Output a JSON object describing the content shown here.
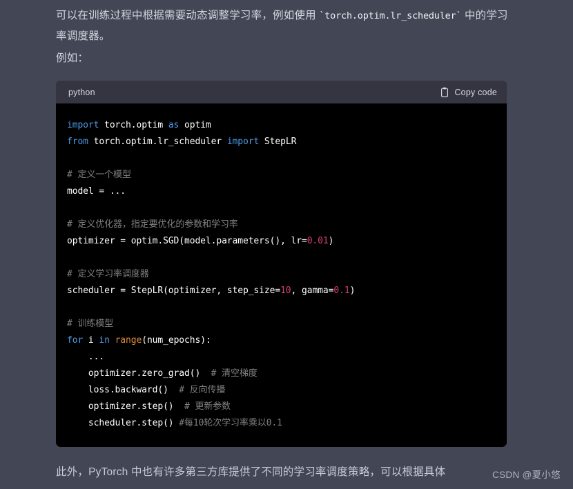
{
  "page": {
    "background_color": "#434654",
    "text_color": "#d2d4de"
  },
  "prose": {
    "intro_before_code": "可以在训练过程中根据需要动态调整学习率，例如使用 ",
    "intro_inline_code": "`torch.optim.lr_scheduler`",
    "intro_after_code": " 中的学习率调度器。",
    "example_label": "例如：",
    "closing": "此外，PyTorch 中也有许多第三方库提供了不同的学习率调度策略，可以根据具体"
  },
  "code_block": {
    "language": "python",
    "copy_label": "Copy code",
    "copy_icon": "clipboard-icon",
    "header_bg": "#343541",
    "body_bg": "#000000",
    "colors": {
      "keyword": "#4e9ae6",
      "builtin": "#e08b3c",
      "number": "#d63f6a",
      "comment": "#808080",
      "plain": "#ffffff"
    },
    "lines": [
      [
        {
          "t": "import",
          "c": "kw"
        },
        {
          "t": " torch.optim ",
          "c": "plain"
        },
        {
          "t": "as",
          "c": "kw"
        },
        {
          "t": " optim",
          "c": "plain"
        }
      ],
      [
        {
          "t": "from",
          "c": "kw"
        },
        {
          "t": " torch.optim.lr_scheduler ",
          "c": "plain"
        },
        {
          "t": "import",
          "c": "kw"
        },
        {
          "t": " StepLR",
          "c": "plain"
        }
      ],
      [],
      [
        {
          "t": "# 定义一个模型",
          "c": "cmt"
        }
      ],
      [
        {
          "t": "model = ...",
          "c": "plain"
        }
      ],
      [],
      [
        {
          "t": "# 定义优化器，指定要优化的参数和学习率",
          "c": "cmt"
        }
      ],
      [
        {
          "t": "optimizer = optim.SGD(model.parameters(), lr=",
          "c": "plain"
        },
        {
          "t": "0.01",
          "c": "num"
        },
        {
          "t": ")",
          "c": "plain"
        }
      ],
      [],
      [
        {
          "t": "# 定义学习率调度器",
          "c": "cmt"
        }
      ],
      [
        {
          "t": "scheduler = StepLR(optimizer, step_size=",
          "c": "plain"
        },
        {
          "t": "10",
          "c": "num"
        },
        {
          "t": ", gamma=",
          "c": "plain"
        },
        {
          "t": "0.1",
          "c": "num"
        },
        {
          "t": ")",
          "c": "plain"
        }
      ],
      [],
      [
        {
          "t": "# 训练模型",
          "c": "cmt"
        }
      ],
      [
        {
          "t": "for",
          "c": "kw"
        },
        {
          "t": " i ",
          "c": "plain"
        },
        {
          "t": "in",
          "c": "kw"
        },
        {
          "t": " ",
          "c": "plain"
        },
        {
          "t": "range",
          "c": "builtin"
        },
        {
          "t": "(num_epochs):",
          "c": "plain"
        }
      ],
      [
        {
          "t": "    ...",
          "c": "plain"
        }
      ],
      [
        {
          "t": "    optimizer.zero_grad()",
          "c": "plain"
        },
        {
          "t": "  # 清空梯度",
          "c": "cmt"
        }
      ],
      [
        {
          "t": "    loss.backward()",
          "c": "plain"
        },
        {
          "t": "  # 反向传播",
          "c": "cmt"
        }
      ],
      [
        {
          "t": "    optimizer.step()",
          "c": "plain"
        },
        {
          "t": "  # 更新参数",
          "c": "cmt"
        }
      ],
      [
        {
          "t": "    scheduler.step()",
          "c": "plain"
        },
        {
          "t": " #每10轮次学习率乘以0.1",
          "c": "cmt"
        }
      ]
    ]
  },
  "watermark": {
    "text": "CSDN @夏小悠"
  }
}
